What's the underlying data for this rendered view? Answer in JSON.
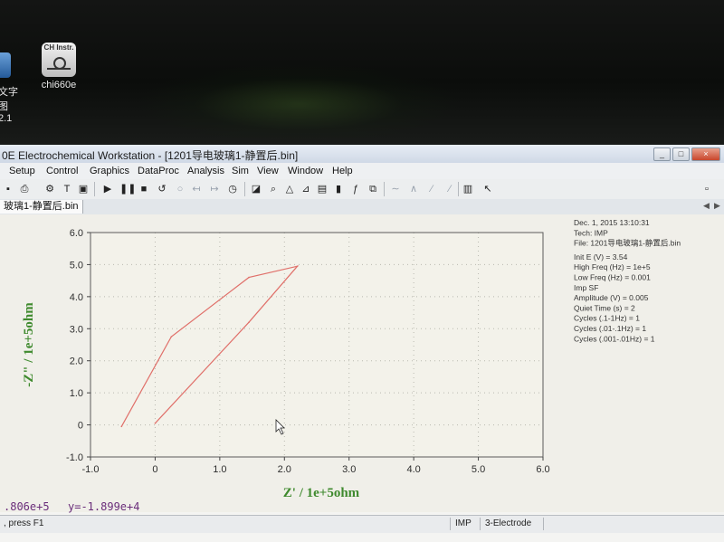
{
  "desktop": {
    "icons": [
      {
        "label": "chi660e",
        "tile_text": "CH Instr."
      },
      {
        "label_line1": "文字图",
        "label_line2": "2.1"
      }
    ]
  },
  "window": {
    "title": "0E Electrochemical Workstation - [1201导电玻璃1-静置后.bin]",
    "controls": [
      "_",
      "□",
      "×"
    ]
  },
  "menu": [
    "Setup",
    "Control",
    "Graphics",
    "DataProc",
    "Analysis",
    "Sim",
    "View",
    "Window",
    "Help"
  ],
  "tab": {
    "label": "玻璃1-静置后.bin"
  },
  "chart_data": {
    "type": "line",
    "xlabel": "Z' / 1e+5ohm",
    "ylabel": "-Z\" / 1e+5ohm",
    "xlim": [
      -1.0,
      6.0
    ],
    "ylim": [
      -1.0,
      6.0
    ],
    "xticks": [
      "-1.0",
      "0",
      "1.0",
      "2.0",
      "3.0",
      "4.0",
      "5.0",
      "6.0"
    ],
    "yticks": [
      "6.0",
      "5.0",
      "4.0",
      "3.0",
      "2.0",
      "1.0",
      "0",
      "-1.0"
    ],
    "grid": true,
    "series": [
      {
        "x": [
          -0.52,
          0.25,
          1.45,
          2.2,
          1.45,
          0.0
        ],
        "y": [
          -0.05,
          2.75,
          4.6,
          4.95,
          3.2,
          0.05
        ]
      }
    ],
    "color": "#e0706a"
  },
  "info": [
    "Dec. 1, 2015   13:10:31",
    "Tech: IMP",
    "File: 1201导电玻璃1-静置后.bin",
    "Init E (V) = 3.54",
    "High Freq (Hz) = 1e+5",
    "Low Freq (Hz) = 0.001",
    "Imp SF",
    "Amplitude (V) = 0.005",
    "Quiet Time (s) = 2",
    "Cycles (.1-1Hz) = 1",
    "Cycles (.01-.1Hz) = 1",
    "Cycles (.001-.01Hz) = 1"
  ],
  "readout": {
    "x_text": ".806e+5",
    "y_text": "y=-1.899e+4"
  },
  "status": {
    "hint": ", press F1",
    "tech": "IMP",
    "electrode": "3-Electrode"
  }
}
